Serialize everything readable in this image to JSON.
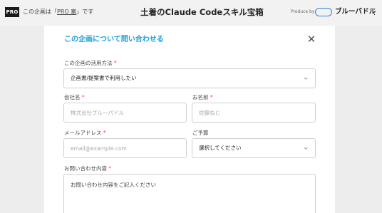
{
  "header": {
    "pro_badge": "PRO",
    "pro_note_prefix": "この企画は「",
    "pro_note_link": "PRO 案",
    "pro_note_suffix": "」です",
    "site_title": "土着のClaude Codeスキル宝箱",
    "produce_by": "Produce by",
    "logo_text": "ブルーパドル",
    "menu_icon": "kebab-menu-icon"
  },
  "modal": {
    "title": "この企画について問い合わせる",
    "close_icon": "close-icon",
    "required_mark": "*",
    "fields": {
      "usage": {
        "label": "この企画の活用方法",
        "value": "企画書/提案書で利用したい"
      },
      "company": {
        "label": "会社名",
        "placeholder": "株式会社ブルーパドル"
      },
      "name": {
        "label": "お名前",
        "placeholder": "佐藤ねじ"
      },
      "email": {
        "label": "メールアドレス",
        "placeholder": "email@example.com"
      },
      "budget": {
        "label": "ご予算",
        "value": "選択してください"
      },
      "inquiry": {
        "label": "お問い合わせ内容",
        "placeholder": "お問い合わせ内容をご記入ください"
      }
    }
  },
  "colors": {
    "accent": "#1e9fd6",
    "required": "#e0534a",
    "logo_blue": "#2e86de"
  }
}
